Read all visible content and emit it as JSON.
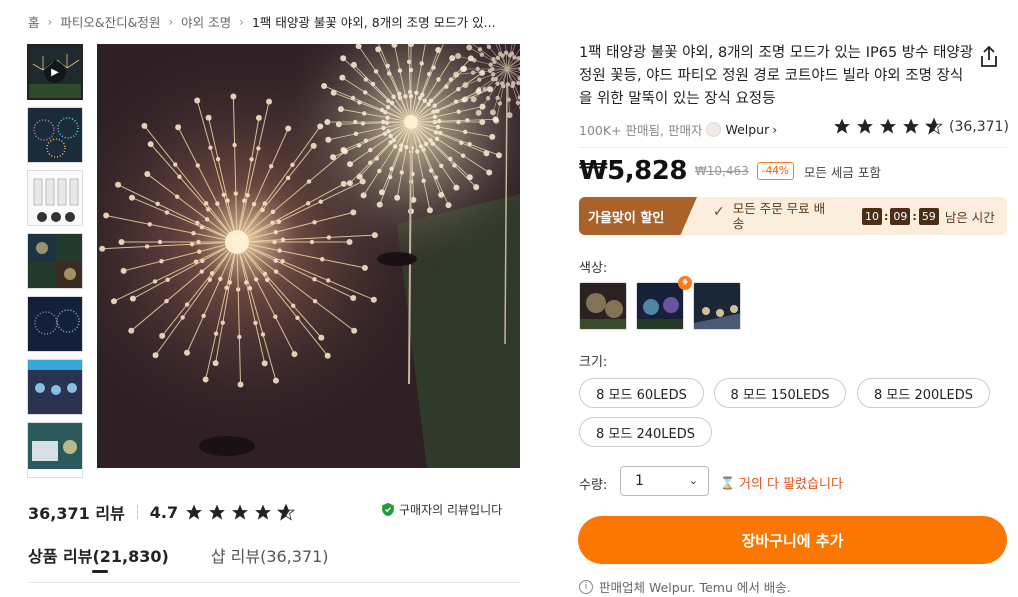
{
  "breadcrumb": {
    "items": [
      "홈",
      "파티오&잔디&정원",
      "야외 조명"
    ],
    "current": "1팩 태양광 불꽃 야외, 8개의 조명 모드가 있..."
  },
  "product": {
    "title": "1팩 태양광 불꽃 야외, 8개의 조명 모드가 있는 IP65 방수 태양광 정원 꽃등, 야드 파티오 정원 경로 코트야드 빌라 야외 조명 장식을 위한 말뚝이 있는 장식 요정등",
    "sold": "100K+ 판매됨, 판매자",
    "seller": "Welpur",
    "rating_count": "(36,371)",
    "price": "₩5,828",
    "old_price": "₩10,463",
    "discount": "-44%",
    "tax_note": "모든 세금 포함"
  },
  "promo": {
    "label": "가을맞이 할인",
    "free_shipping": "모든 주문 무료 배송",
    "timer": {
      "h": "10",
      "m": "09",
      "s": "59",
      "label": "남은 시간"
    }
  },
  "options": {
    "color_label": "색상:",
    "size_label": "크기:",
    "sizes": [
      "8 모드 60LEDS",
      "8 모드 150LEDS",
      "8 모드 200LEDS",
      "8 모드 240LEDS"
    ],
    "qty_label": "수량:",
    "qty_value": "1",
    "almost_sold": "거의 다 팔렸습니다"
  },
  "cart_button": "장바구니에 추가",
  "ship_note": "판매업체 Welpur. Temu 에서 배송.",
  "reviews": {
    "count": "36,371 리뷰",
    "score": "4.7",
    "verified": "구매자의 리뷰입니다",
    "tab_product": "상품 리뷰(21,830)",
    "tab_shop": "샵 리뷰(36,371)"
  },
  "colors": {
    "accent": "#fb7701",
    "promo_dark": "#a9622a",
    "promo_bg": "#fbeedd",
    "discount": "#ff5a00"
  }
}
